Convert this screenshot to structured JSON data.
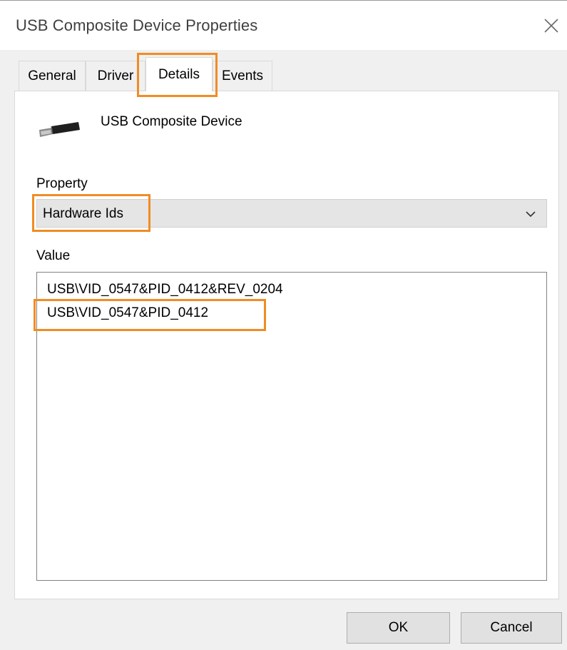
{
  "window": {
    "title": "USB Composite Device Properties"
  },
  "tabs": [
    {
      "label": "General",
      "active": false
    },
    {
      "label": "Driver",
      "active": false
    },
    {
      "label": "Details",
      "active": true
    },
    {
      "label": "Events",
      "active": false
    }
  ],
  "device": {
    "name": "USB Composite Device",
    "icon": "usb-connector-icon"
  },
  "property": {
    "label": "Property",
    "selected": "Hardware Ids"
  },
  "value": {
    "label": "Value",
    "lines": [
      "USB\\VID_0547&PID_0412&REV_0204",
      "USB\\VID_0547&PID_0412"
    ]
  },
  "buttons": {
    "ok": "OK",
    "cancel": "Cancel"
  },
  "colors": {
    "highlight": "#f08c24",
    "dialog_bg": "#f0f0f0"
  }
}
